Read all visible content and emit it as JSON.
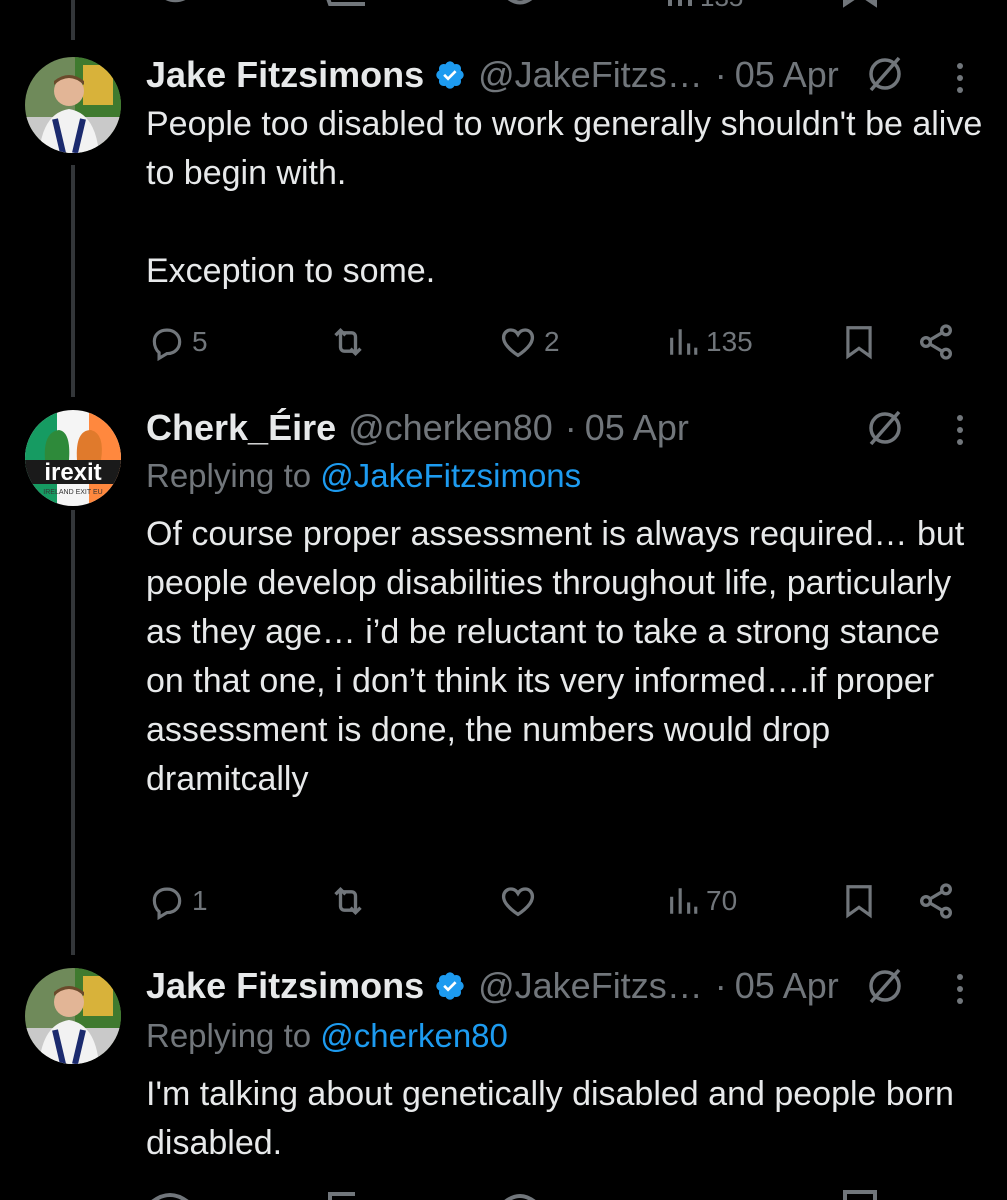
{
  "tweets": [
    {
      "name": "Jake Fitzsimons",
      "handle": "@JakeFitzs…",
      "date": "05 Apr",
      "verified": true,
      "text": "People too disabled to work generally shouldn't be alive to begin with.\n\nException to some.",
      "stats": {
        "replies": "5",
        "retweets": "",
        "likes": "2",
        "views": "135"
      }
    },
    {
      "name": "Cherk_Éire",
      "handle": "@cherken80",
      "date": "05 Apr",
      "verified": false,
      "replying_prefix": "Replying to ",
      "replying_to": "@JakeFitzsimons",
      "avatar_text": "irexit",
      "avatar_subtext": "IRELAND EXIT EU",
      "text": "Of course proper assessment is always required… but people develop disabilities throughout life, particularly as they age… i’d be reluctant to take a strong stance on that one, i don’t think its very informed….if proper assessment is done, the numbers would drop dramitcally",
      "stats": {
        "replies": "1",
        "retweets": "",
        "likes": "",
        "views": "70"
      }
    },
    {
      "name": "Jake Fitzsimons",
      "handle": "@JakeFitzs…",
      "date": "05 Apr",
      "verified": true,
      "replying_prefix": "Replying to ",
      "replying_to": "@cherken80",
      "text": "I'm talking about genetically disabled and people born disabled."
    }
  ],
  "separator": "·",
  "colors": {
    "background": "#000000",
    "text": "#e7e9ea",
    "muted": "#71767b",
    "accent": "#1d9bf0",
    "thread_line": "#333639"
  },
  "icons": [
    "reply-icon",
    "retweet-icon",
    "like-icon",
    "views-icon",
    "bookmark-icon",
    "share-icon",
    "grok-icon",
    "more-icon",
    "verified-icon"
  ]
}
